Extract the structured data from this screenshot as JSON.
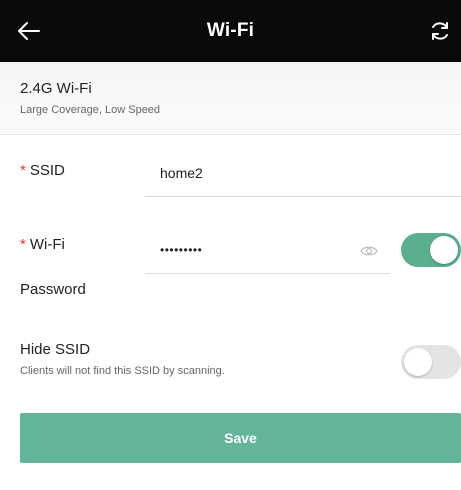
{
  "header": {
    "title": "Wi-Fi",
    "back_icon": "arrow-left-icon",
    "refresh_icon": "refresh-icon"
  },
  "band": {
    "title": "2.4G Wi-Fi",
    "subtitle": "Large Coverage, Low Speed"
  },
  "ssid": {
    "required_mark": "*",
    "label": "SSID",
    "value": "home2"
  },
  "password": {
    "required_mark": "*",
    "label_line1": "Wi-Fi",
    "label_line2": "Password",
    "value_masked": "•••••••••",
    "eye_icon": "eye-icon",
    "toggle_on": true
  },
  "hide_ssid": {
    "label": "Hide SSID",
    "subtitle": "Clients will not find this SSID by scanning.",
    "toggle_on": false
  },
  "actions": {
    "save_label": "Save"
  },
  "colors": {
    "accent": "#5aaf8e",
    "save_button": "#62b596",
    "required": "#e53935",
    "header_bg": "#0a0a0a"
  }
}
